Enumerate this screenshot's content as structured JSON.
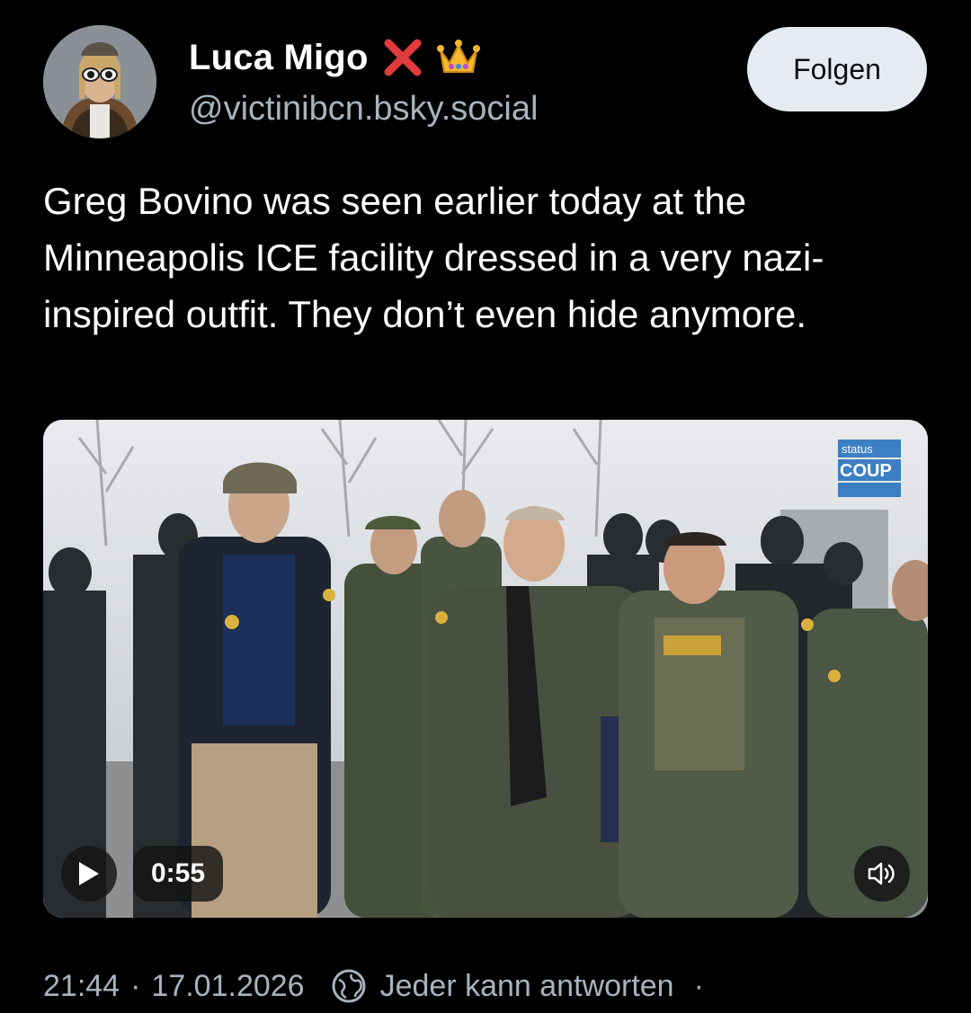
{
  "post": {
    "author": {
      "display_name": "Luca Migo",
      "badges": [
        "cross-mark-emoji",
        "crown-emoji"
      ],
      "handle": "@victinibcn.bsky.social",
      "avatar": "avatar-photo"
    },
    "follow_label": "Folgen",
    "text": "Greg Bovino was seen earlier today at the Minneapolis ICE facility dressed in a very nazi-inspired outfit. They don’t even hide anymore.",
    "video": {
      "duration": "0:55",
      "play_icon": "play-icon",
      "volume_icon": "volume-icon",
      "watermark_lines": [
        "status",
        "COUP"
      ]
    },
    "meta": {
      "time": "21:44",
      "separator": "·",
      "date": "17.01.2026",
      "reply_setting": "Jeder kann antworten",
      "trailing_separator": "·",
      "reply_icon": "globe-icon"
    }
  },
  "colors": {
    "background": "#000000",
    "secondary_text": "#a9b3bf",
    "follow_button_bg": "#e6ebf2"
  }
}
